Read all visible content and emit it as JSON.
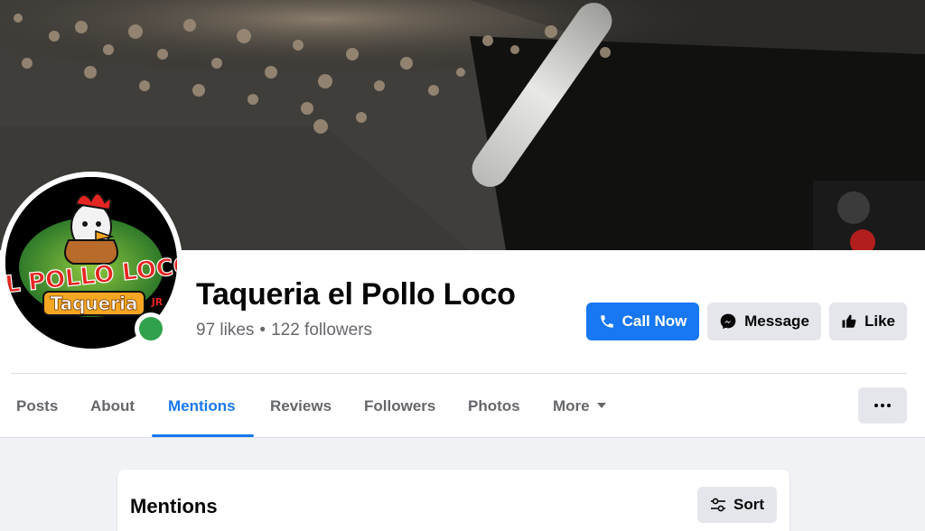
{
  "page": {
    "name": "Taqueria el Pollo Loco",
    "likes": "97 likes",
    "separator": "•",
    "followers": "122 followers",
    "logo_text_main": "EL POLLO LOCO",
    "logo_text_sub": "Taqueria",
    "logo_text_badge": "JR"
  },
  "actions": {
    "call_now": "Call Now",
    "message": "Message",
    "like": "Like"
  },
  "tabs": [
    {
      "label": "Posts"
    },
    {
      "label": "About"
    },
    {
      "label": "Mentions"
    },
    {
      "label": "Reviews"
    },
    {
      "label": "Followers"
    },
    {
      "label": "Photos"
    },
    {
      "label": "More"
    }
  ],
  "mentions_card": {
    "title": "Mentions",
    "sort_label": "Sort"
  },
  "colors": {
    "primary": "#1877f2",
    "online": "#31a24c",
    "secondary_button": "#e4e6eb"
  },
  "icons": [
    "phone-icon",
    "messenger-icon",
    "thumbs-up-icon",
    "caret-down-icon",
    "more-dots-icon",
    "sliders-icon"
  ]
}
